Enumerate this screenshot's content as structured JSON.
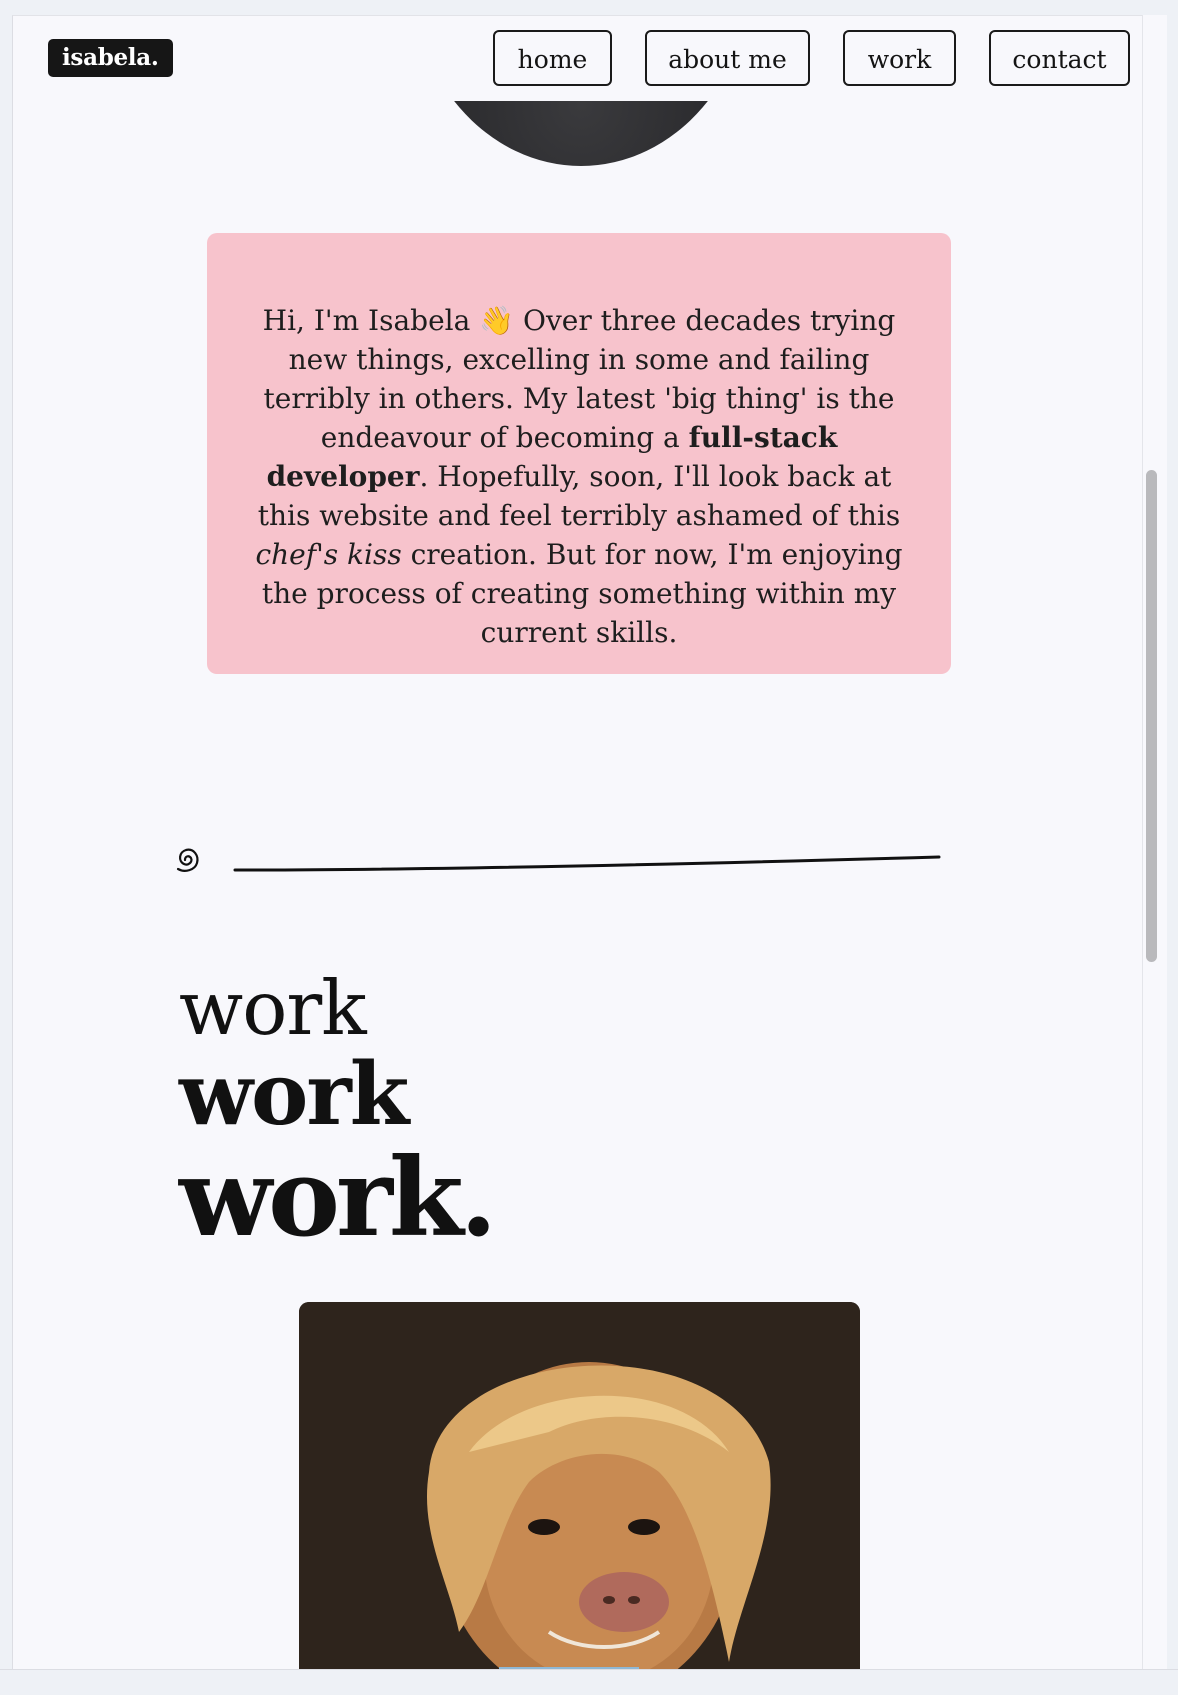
{
  "header": {
    "logo": "isabela.",
    "nav": [
      {
        "label": "home"
      },
      {
        "label": "about me"
      },
      {
        "label": "work"
      },
      {
        "label": "contact"
      }
    ]
  },
  "intro": {
    "greeting": "Hi, I'm Isabela",
    "wave_emoji": "👋",
    "text_1": " Over three decades trying new things, excelling in some and failing terribly in others. My latest 'big thing' is the endeavour of becoming a ",
    "bold": "full-stack developer",
    "text_2": ". Hopefully, soon, I'll look back at this website and feel terribly ashamed of this ",
    "italic": "chef's kiss",
    "text_3": " creation. But for now, I'm enjoying the process of creating something within my current skills."
  },
  "work": {
    "line1": "work",
    "line2": "work",
    "line3": "work."
  },
  "colors": {
    "card_pink": "#f7c3cc",
    "page_bg": "#f8f8fc",
    "ink": "#141414"
  },
  "icons": {
    "divider_spiral": "spiral-icon"
  }
}
